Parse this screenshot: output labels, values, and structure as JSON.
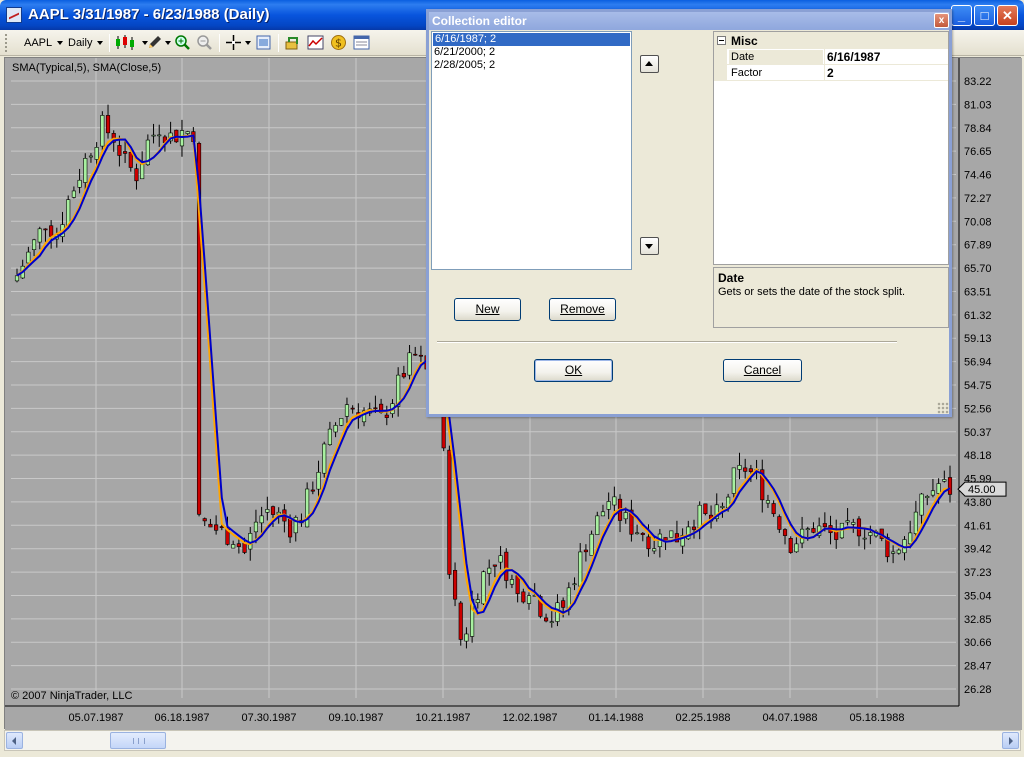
{
  "window": {
    "title": "AAPL  3/31/1987 - 6/23/1988 (Daily)",
    "minimize": "_",
    "maximize": "□",
    "close": "✕"
  },
  "toolbar": {
    "instrument": "AAPL",
    "period": "Daily",
    "icons": [
      "candlestick-icon",
      "pencil-icon",
      "zoom-in-icon",
      "zoom-out-icon",
      "crosshair-icon",
      "properties-icon",
      "strategy-icon",
      "indicator-icon",
      "money-icon",
      "data-box-icon"
    ]
  },
  "chart": {
    "indicator_label": "SMA(Typical,5), SMA(Close,5)",
    "copyright": "© 2007 NinjaTrader, LLC",
    "last_price": "45.00",
    "colors": {
      "background": "#a7a7a7",
      "grid": "#c8c8c8",
      "up_candle": "#a8f0a0",
      "down_candle": "#cc0000",
      "sma_typical": "#0000c8",
      "sma_close": "#ffa500"
    }
  },
  "chart_data": {
    "type": "candlestick",
    "y_ticks": [
      "83.22",
      "81.03",
      "78.84",
      "76.65",
      "74.46",
      "72.27",
      "70.08",
      "67.89",
      "65.70",
      "63.51",
      "61.32",
      "59.13",
      "56.94",
      "54.75",
      "52.56",
      "50.37",
      "48.18",
      "45.99",
      "43.80",
      "41.61",
      "39.42",
      "37.23",
      "35.04",
      "32.85",
      "30.66",
      "28.47",
      "26.28"
    ],
    "x_ticks": [
      "05.07.1987",
      "06.18.1987",
      "07.30.1987",
      "09.10.1987",
      "10.21.1987",
      "12.02.1987",
      "01.14.1988",
      "02.25.1988",
      "04.07.1988",
      "05.18.1988"
    ],
    "ylim": [
      26.28,
      83.22
    ],
    "series": [
      {
        "name": "SMA(Typical,5)",
        "color": "#0000c8"
      },
      {
        "name": "SMA(Close,5)",
        "color": "#ffa500"
      }
    ],
    "price_path": [
      [
        0,
        65.0
      ],
      [
        3,
        68.0
      ],
      [
        5,
        70.0
      ],
      [
        7,
        69.0
      ],
      [
        9,
        72.0
      ],
      [
        11,
        74.5
      ],
      [
        13,
        77.0
      ],
      [
        15,
        79.0
      ],
      [
        17,
        78.0
      ],
      [
        19,
        75.5
      ],
      [
        21,
        74.5
      ],
      [
        23,
        77.5
      ],
      [
        25,
        79.0
      ],
      [
        27,
        78.0
      ],
      [
        29,
        78.5
      ],
      [
        31,
        78.5
      ],
      [
        32,
        42.0
      ],
      [
        34,
        41.5
      ],
      [
        36,
        41.0
      ],
      [
        38,
        40.5
      ],
      [
        40,
        39.0
      ],
      [
        42,
        42.0
      ],
      [
        44,
        43.0
      ],
      [
        46,
        42.5
      ],
      [
        48,
        41.5
      ],
      [
        50,
        42.5
      ],
      [
        52,
        45.5
      ],
      [
        54,
        48.5
      ],
      [
        56,
        51.0
      ],
      [
        58,
        53.0
      ],
      [
        60,
        52.5
      ],
      [
        62,
        52.0
      ],
      [
        64,
        51.5
      ],
      [
        66,
        53.5
      ],
      [
        68,
        56.0
      ],
      [
        70,
        57.5
      ],
      [
        72,
        56.0
      ],
      [
        74,
        54.5
      ],
      [
        75,
        48.0
      ],
      [
        76,
        38.0
      ],
      [
        77,
        34.0
      ],
      [
        78,
        31.0
      ],
      [
        79,
        32.0
      ],
      [
        80,
        34.5
      ],
      [
        82,
        37.0
      ],
      [
        84,
        38.5
      ],
      [
        86,
        37.5
      ],
      [
        88,
        35.0
      ],
      [
        90,
        36.0
      ],
      [
        92,
        34.0
      ],
      [
        94,
        33.0
      ],
      [
        96,
        34.0
      ],
      [
        98,
        37.0
      ],
      [
        100,
        40.0
      ],
      [
        102,
        42.0
      ],
      [
        104,
        44.0
      ],
      [
        106,
        42.5
      ],
      [
        108,
        41.5
      ],
      [
        110,
        41.0
      ],
      [
        112,
        40.0
      ],
      [
        114,
        41.0
      ],
      [
        116,
        40.5
      ],
      [
        118,
        42.0
      ],
      [
        120,
        42.5
      ],
      [
        122,
        42.0
      ],
      [
        124,
        43.0
      ],
      [
        126,
        46.0
      ],
      [
        128,
        47.0
      ],
      [
        130,
        46.0
      ],
      [
        132,
        44.0
      ],
      [
        134,
        42.0
      ],
      [
        136,
        40.0
      ],
      [
        138,
        40.5
      ],
      [
        140,
        41.5
      ],
      [
        142,
        41.0
      ],
      [
        144,
        40.5
      ],
      [
        146,
        41.0
      ],
      [
        148,
        41.5
      ],
      [
        150,
        41.0
      ],
      [
        152,
        40.0
      ],
      [
        154,
        39.0
      ],
      [
        156,
        40.5
      ],
      [
        158,
        42.5
      ],
      [
        160,
        44.5
      ],
      [
        162,
        45.5
      ],
      [
        164,
        45.0
      ]
    ],
    "last_index": 164
  },
  "dialog": {
    "title": "Collection editor",
    "close": "x",
    "list": [
      "6/16/1987; 2",
      "6/21/2000; 2",
      "2/28/2005; 2"
    ],
    "selected_index": 0,
    "property_grid": {
      "category": "Misc",
      "rows": [
        {
          "name": "Date",
          "value": "6/16/1987"
        },
        {
          "name": "Factor",
          "value": "2"
        }
      ]
    },
    "description": {
      "title": "Date",
      "text": "Gets or sets the date of the stock split."
    },
    "buttons": {
      "new": "New",
      "remove": "Remove",
      "ok": "OK",
      "cancel": "Cancel"
    }
  }
}
